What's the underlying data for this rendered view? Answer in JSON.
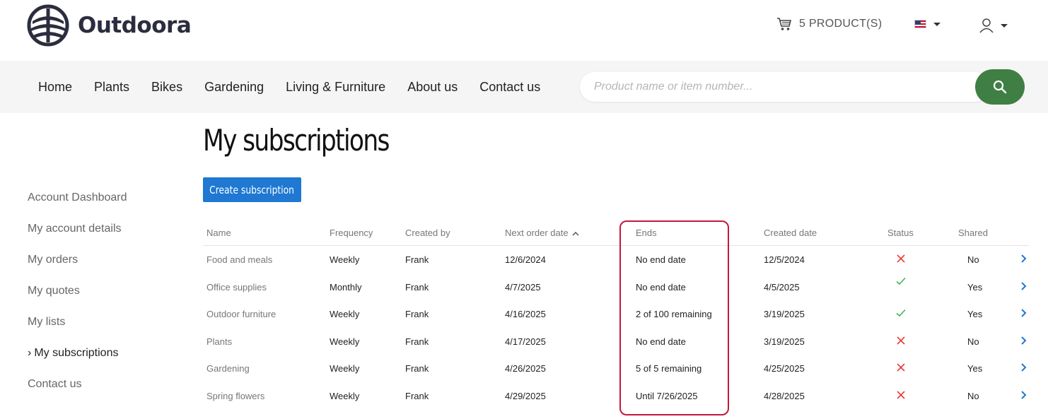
{
  "brand": {
    "name": "Outdoora"
  },
  "header": {
    "cart_label": "5 PRODUCT(S)"
  },
  "nav": {
    "items": [
      "Home",
      "Plants",
      "Bikes",
      "Gardening",
      "Living & Furniture",
      "About us",
      "Contact us"
    ],
    "search_placeholder": "Product name or item number..."
  },
  "sidebar": {
    "items": [
      {
        "label": "Account Dashboard",
        "active": false
      },
      {
        "label": "My account details",
        "active": false
      },
      {
        "label": "My orders",
        "active": false
      },
      {
        "label": "My quotes",
        "active": false
      },
      {
        "label": "My lists",
        "active": false
      },
      {
        "label": "My subscriptions",
        "active": true,
        "marker": "›"
      },
      {
        "label": "Contact us",
        "active": false
      }
    ]
  },
  "main": {
    "title": "My subscriptions",
    "create_label": "Create subscription"
  },
  "table": {
    "columns": [
      "Name",
      "Frequency",
      "Created by",
      "Next order date",
      "Ends",
      "Created date",
      "Status",
      "Shared"
    ],
    "rows": [
      {
        "name": "Food and meals",
        "frequency": "Weekly",
        "created_by": "Frank",
        "next_order": "12/6/2024",
        "ends": "No end date",
        "created": "12/5/2024",
        "status": "inactive",
        "shared": "No"
      },
      {
        "name": "Office supplies",
        "frequency": "Monthly",
        "created_by": "Frank",
        "next_order": "4/7/2025",
        "ends": "No end date",
        "created": "4/5/2025",
        "status": "active",
        "shared": "Yes"
      },
      {
        "name": "Outdoor furniture",
        "frequency": "Weekly",
        "created_by": "Frank",
        "next_order": "4/16/2025",
        "ends": "2 of 100 remaining",
        "created": "3/19/2025",
        "status": "active",
        "shared": "Yes"
      },
      {
        "name": "Plants",
        "frequency": "Weekly",
        "created_by": "Frank",
        "next_order": "4/17/2025",
        "ends": "No end date",
        "created": "3/19/2025",
        "status": "inactive",
        "shared": "No"
      },
      {
        "name": "Gardening",
        "frequency": "Weekly",
        "created_by": "Frank",
        "next_order": "4/26/2025",
        "ends": "5 of 5 remaining",
        "created": "4/25/2025",
        "status": "inactive",
        "shared": "Yes"
      },
      {
        "name": "Spring flowers",
        "frequency": "Weekly",
        "created_by": "Frank",
        "next_order": "4/29/2025",
        "ends": "Until 7/26/2025",
        "created": "4/28/2025",
        "status": "inactive",
        "shared": "No"
      }
    ]
  },
  "colors": {
    "accent_blue": "#1f78d1",
    "search_green": "#3f7f44",
    "status_ok": "#4caf50",
    "status_bad": "#e53935",
    "highlight": "#c4183c"
  }
}
